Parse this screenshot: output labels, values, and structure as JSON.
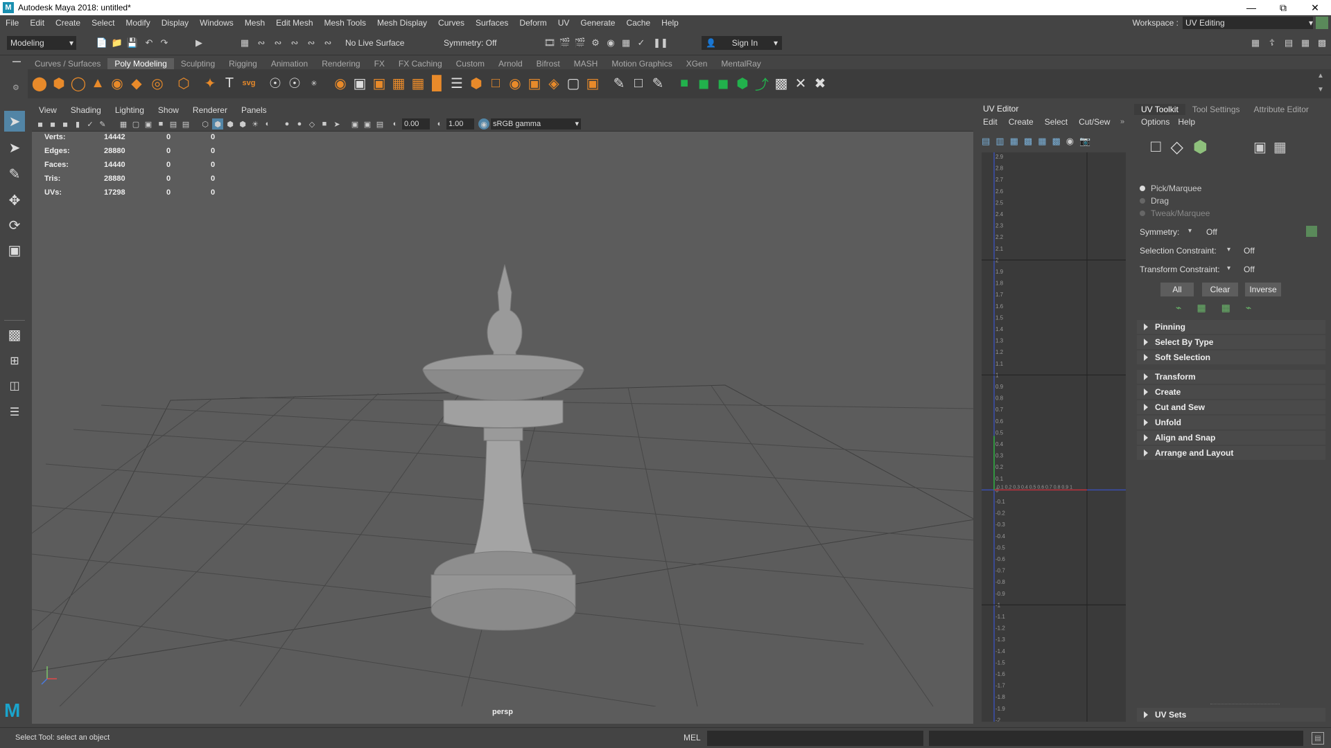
{
  "window": {
    "title": "Autodesk Maya 2018: untitled*",
    "logo": "M"
  },
  "menubar": {
    "items": [
      "File",
      "Edit",
      "Create",
      "Select",
      "Modify",
      "Display",
      "Windows",
      "Mesh",
      "Edit Mesh",
      "Mesh Tools",
      "Mesh Display",
      "Curves",
      "Surfaces",
      "Deform",
      "UV",
      "Generate",
      "Cache",
      "Help"
    ],
    "workspace_label": "Workspace :",
    "workspace_value": "UV Editing"
  },
  "statusline": {
    "mode": "Modeling",
    "live_surface": "No Live Surface",
    "symmetry": "Symmetry: Off",
    "sign_in": "Sign In"
  },
  "shelf": {
    "tabs": [
      "Curves / Surfaces",
      "Poly Modeling",
      "Sculpting",
      "Rigging",
      "Animation",
      "Rendering",
      "FX",
      "FX Caching",
      "Custom",
      "Arnold",
      "Bifrost",
      "MASH",
      "Motion Graphics",
      "XGen",
      "MentalRay"
    ],
    "active_tab": "Poly Modeling"
  },
  "viewport": {
    "menu": [
      "View",
      "Shading",
      "Lighting",
      "Show",
      "Renderer",
      "Panels"
    ],
    "exposure": "0.00",
    "gamma": "1.00",
    "colorspace": "sRGB gamma",
    "camera": "persp",
    "hud": [
      {
        "label": "Verts:",
        "v1": "14442",
        "v2": "0",
        "v3": "0"
      },
      {
        "label": "Edges:",
        "v1": "28880",
        "v2": "0",
        "v3": "0"
      },
      {
        "label": "Faces:",
        "v1": "14440",
        "v2": "0",
        "v3": "0"
      },
      {
        "label": "Tris:",
        "v1": "28880",
        "v2": "0",
        "v3": "0"
      },
      {
        "label": "UVs:",
        "v1": "17298",
        "v2": "0",
        "v3": "0"
      }
    ]
  },
  "uv_editor": {
    "title": "UV Editor",
    "menu": [
      "Edit",
      "Create",
      "Select",
      "Cut/Sew"
    ],
    "v_labels": [
      "2.9",
      "2.8",
      "2.7",
      "2.6",
      "2.5",
      "2.4",
      "2.3",
      "2.2",
      "2.1",
      "2",
      "1.9",
      "1.8",
      "1.7",
      "1.6",
      "1.5",
      "1.4",
      "1.3",
      "1.2",
      "1.1",
      "1",
      "0.9",
      "0.8",
      "0.7",
      "0.6",
      "0.5",
      "0.4",
      "0.3",
      "0.2",
      "0.1",
      "0",
      "-0.1",
      "-0.2",
      "-0.3",
      "-0.4",
      "-0.5",
      "-0.6",
      "-0.7",
      "-0.8",
      "-0.9",
      "-1",
      "-1.1",
      "-1.2",
      "-1.3",
      "-1.4",
      "-1.5",
      "-1.6",
      "-1.7",
      "-1.8",
      "-1.9",
      "-2"
    ],
    "u_labels": "0.1 0.2 0.3 0.4 0.5 0.6 0.7 0.8 0.9 1"
  },
  "uv_toolkit": {
    "tabs": [
      "UV Toolkit",
      "Tool Settings",
      "Attribute Editor"
    ],
    "menu": [
      "Options",
      "Help"
    ],
    "modes": [
      "Pick/Marquee",
      "Drag",
      "Tweak/Marquee"
    ],
    "symmetry_label": "Symmetry:",
    "symmetry_value": "Off",
    "selection_constraint_label": "Selection Constraint:",
    "selection_constraint_value": "Off",
    "transform_constraint_label": "Transform Constraint:",
    "transform_constraint_value": "Off",
    "buttons": [
      "All",
      "Clear",
      "Inverse"
    ],
    "sections": [
      "Pinning",
      "Select By Type",
      "Soft Selection",
      "Transform",
      "Create",
      "Cut and Sew",
      "Unfold",
      "Align and Snap",
      "Arrange and Layout"
    ],
    "footer_section": "UV Sets"
  },
  "commandline": {
    "help": "Select Tool: select an object",
    "lang": "MEL"
  }
}
